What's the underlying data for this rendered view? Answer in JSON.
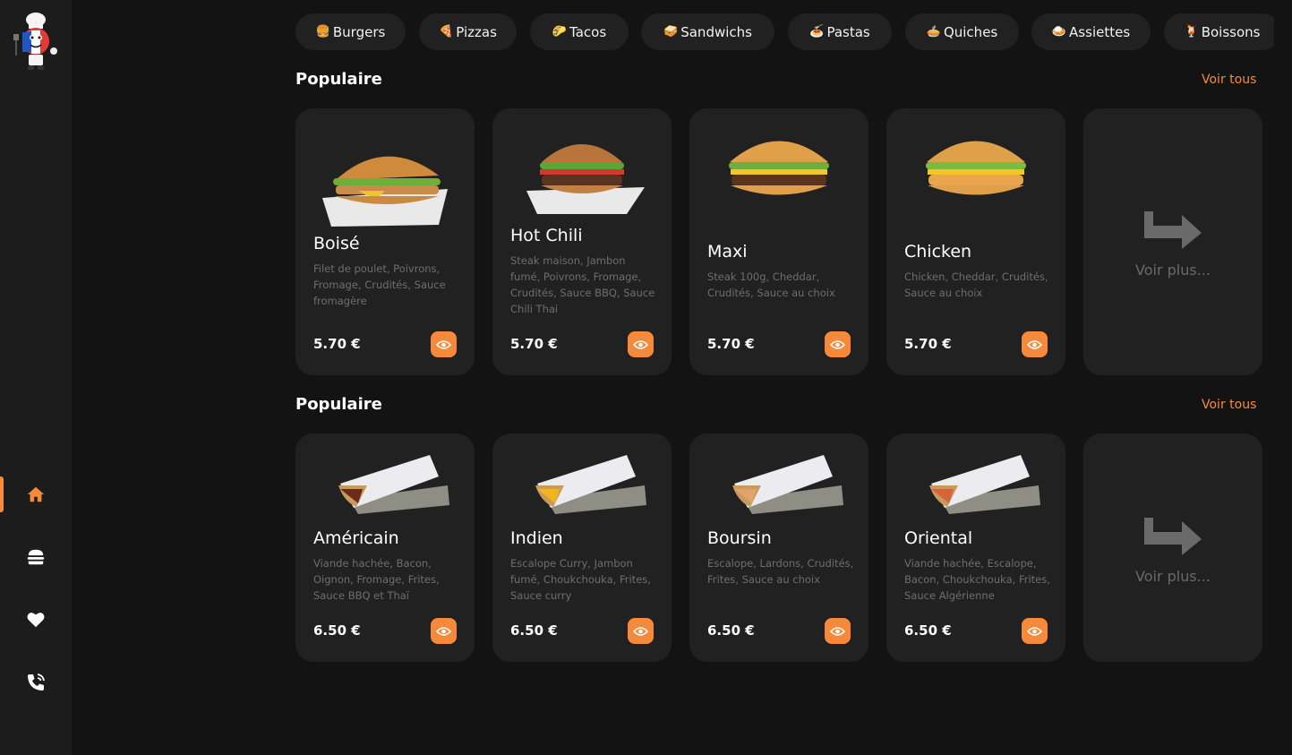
{
  "categories": [
    {
      "emoji": "🍔",
      "label": "Burgers"
    },
    {
      "emoji": "🍕",
      "label": "Pizzas"
    },
    {
      "emoji": "🌮",
      "label": "Tacos"
    },
    {
      "emoji": "🥪",
      "label": "Sandwichs"
    },
    {
      "emoji": "🍝",
      "label": "Pastas"
    },
    {
      "emoji": "🥧",
      "label": "Quiches"
    },
    {
      "emoji": "🍛",
      "label": "Assiettes"
    },
    {
      "emoji": "🍹",
      "label": "Boissons"
    }
  ],
  "sections": [
    {
      "title": "Populaire",
      "see_all": "Voir tous",
      "items": [
        {
          "name": "Boisé",
          "desc": "Filet de poulet, Poivrons, Fromage, Crudités, Sauce fromagère",
          "price": "5.70 €"
        },
        {
          "name": "Hot Chili",
          "desc": "Steak maison, Jambon fumé, Poivrons, Fromage, Crudités, Sauce BBQ, Sauce Chili Thai",
          "price": "5.70 €"
        },
        {
          "name": "Maxi",
          "desc": "Steak 100g, Cheddar, Crudités, Sauce au choix",
          "price": "5.70 €"
        },
        {
          "name": "Chicken",
          "desc": "Chicken, Cheddar, Crudités, Sauce au choix",
          "price": "5.70 €"
        }
      ],
      "more_label": "Voir plus..."
    },
    {
      "title": "Populaire",
      "see_all": "Voir tous",
      "items": [
        {
          "name": "Américain",
          "desc": "Viande hachée, Bacon, Oignon, Fromage, Frites, Sauce BBQ et Thaï",
          "price": "6.50 €"
        },
        {
          "name": "Indien",
          "desc": "Escalope Curry, Jambon fumé, Choukchouka, Frites, Sauce curry",
          "price": "6.50 €"
        },
        {
          "name": "Boursin",
          "desc": "Escalope, Lardons, Crudités, Frites, Sauce au choix",
          "price": "6.50 €"
        },
        {
          "name": "Oriental",
          "desc": "Viande hachée, Escalope, Bacon, Choukchouka, Frites, Sauce Algérienne",
          "price": "6.50 €"
        }
      ],
      "more_label": "Voir plus..."
    }
  ],
  "nav": [
    {
      "icon": "home-icon",
      "active": true
    },
    {
      "icon": "burger-icon",
      "active": false
    },
    {
      "icon": "heart-icon",
      "active": false
    },
    {
      "icon": "phone-icon",
      "active": false
    }
  ],
  "colors": {
    "accent": "#f7893b",
    "card": "#212121",
    "background": "#131313",
    "sidebar": "#1c1c1c"
  }
}
